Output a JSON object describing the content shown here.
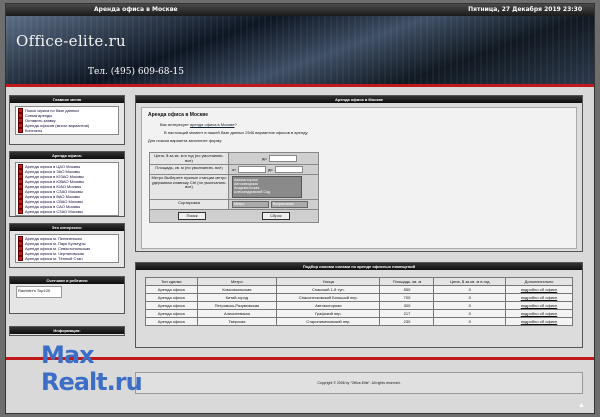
{
  "topbar": {
    "title": "Аренда офиса в Москве",
    "date": "Пятница, 27 Декабря 2019 23:30"
  },
  "header": {
    "brand": "Office-elite.ru",
    "phone": "Тел. (495) 609-68-15"
  },
  "sidebar": {
    "main_menu": {
      "title": "Главное меню",
      "items": [
        "Поиск офиса по базе данных",
        "Схема аренды",
        "Оставить заявку",
        "Аренда офисов (много вариантов)",
        "Контакты"
      ]
    },
    "offices": {
      "title": "Аренда офиса:",
      "items": [
        "Аренда офиса в ЦАО Москвы",
        "Аренда офиса в ЗАО Москвы",
        "Аренда офиса в ЮЗАО Москвы",
        "Аренда офиса в ЮВАО Москвы",
        "Аренда офиса в ЮАО Москвы",
        "Аренда офиса в СЗАО Москвы",
        "Аренда офиса в ВАО Москвы",
        "Аренда офиса в СВАО Москвы",
        "Аренда офиса в САО Москвы",
        "Аренда офиса в СЗАО Москвы"
      ]
    },
    "interest": {
      "title": "Это интересно:",
      "items": [
        "Аренда офиса м. Пенягинская",
        "Аренда офиса м. Парк Культуры",
        "Аренда офиса м. Севастопольская",
        "Аренда офиса м. Чертановская",
        "Аренда офиса м. Тёплый Стан"
      ]
    },
    "counters": {
      "title": "Счетчики и рейтинги",
      "counter_label": "Rambler's Top100"
    },
    "info": {
      "title": "Информация:"
    }
  },
  "main": {
    "title": "Аренда офиса в Москве",
    "heading": "Аренда офиса в Москве",
    "intro_prefix": "Вас интересует",
    "intro_link": "аренда офиса в Москве",
    "intro_suffix": "?",
    "count_text": "В настоящий момент в нашей базе данных 2546 вариантов офисов в аренду.",
    "form_intro": "Для поиска варианта заполните форму:",
    "form": {
      "price_label": "Цена, $ за кв. м в год (по умолчанию- все)",
      "price_to": "до",
      "area_label": "Площадь, кв. м (по умолчанию- все)",
      "from": "от",
      "to": "до",
      "metro_label": "Метро Выберите нужные станции метро удерживая клавишу Ctrl (по умолчанию- все)",
      "metro_options": [
        "Авиамоторная",
        "Автозаводская",
        "Академическая",
        "Александровский Сад"
      ],
      "sort_label": "Сортировка",
      "sort_field": "Метро",
      "sort_order": "Возрастание",
      "search_button": "Поиск",
      "reset_button": "Сброс"
    }
  },
  "results": {
    "title": "Подбор своими силами по аренде офисных помещений",
    "columns": [
      "Тип сделки",
      "Метро",
      "Улица",
      "Площадь, кв. м",
      "Цена, $ за кв. м в год",
      "Дополнительно"
    ],
    "rows": [
      [
        "Аренда офиса",
        "Комсомольская",
        "Спасский 1-й туп.",
        "550",
        "0",
        "подробно об офисе"
      ],
      [
        "Аренда офиса",
        "Китай-город",
        "Спасопесковский Большой пер.",
        "700",
        "0",
        "подробно об офисе"
      ],
      [
        "Аренда офиса",
        "Петровско-Разумовская",
        "Автомоторная",
        "300",
        "0",
        "подробно об офисе"
      ],
      [
        "Аренда офиса",
        "Алексеевская",
        "Графский пер.",
        "217",
        "0",
        "подробно об офисе"
      ],
      [
        "Аренда офиса",
        "Тверская",
        "Старопименовский пер.",
        "230",
        "0",
        "подробно об офисе"
      ]
    ]
  },
  "footer": {
    "copyright": "Copyright © 2006 by \"Office-Elite\". All rights reserved."
  },
  "watermark": {
    "line1": "Max",
    "line2": "Realt.ru"
  },
  "colors": {
    "accent_red": "#c0191c",
    "header_dark": "#1a1a1a",
    "watermark": "#3c6ec8"
  }
}
